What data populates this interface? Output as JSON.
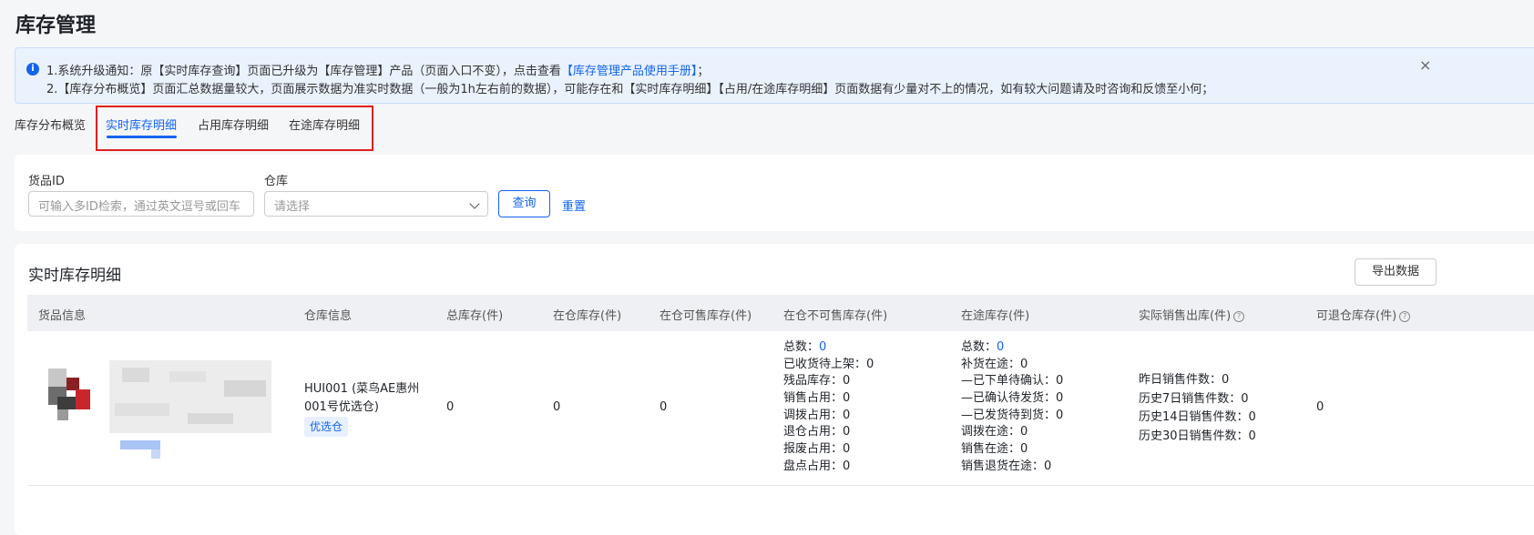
{
  "page": {
    "title": "库存管理"
  },
  "notice": {
    "line1_prefix": "1.系统升级通知：原【实时库存查询】页面已升级为【库存管理】产品（页面入口不变），点击查看",
    "line1_link": "【库存管理产品使用手册】",
    "line1_suffix": "；",
    "line2": "2.【库存分布概览】页面汇总数据量较大，页面展示数据为准实时数据（一般为1h左右前的数据），可能存在和【实时库存明细】【占用/在途库存明细】页面数据有少量对不上的情况，如有较大问题请及时咨询和反馈至小何；",
    "close": "×"
  },
  "tabs": [
    {
      "label": "库存分布概览",
      "active": false
    },
    {
      "label": "实时库存明细",
      "active": true
    },
    {
      "label": "占用库存明细",
      "active": false
    },
    {
      "label": "在途库存明细",
      "active": false
    }
  ],
  "filters": {
    "goods_id_label": "货品ID",
    "goods_id_placeholder": "可输入多ID检索，通过英文逗号或回车",
    "warehouse_label": "仓库",
    "warehouse_placeholder": "请选择",
    "query_button": "查询",
    "reset_button": "重置"
  },
  "table": {
    "title": "实时库存明细",
    "export_button": "导出数据",
    "columns": [
      "货品信息",
      "仓库信息",
      "总库存(件)",
      "在仓库存(件)",
      "在仓可售库存(件)",
      "在仓不可售库存(件)",
      "在途库存(件)",
      "实际销售出库(件)",
      "可退仓库存(件)"
    ],
    "row": {
      "warehouse_name": "HUI001 (菜鸟AE惠州",
      "warehouse_name2": "001号优选仓)",
      "warehouse_tag": "优选仓",
      "total": "0",
      "in_stock": "0",
      "sellable": "0",
      "unsellable": {
        "total_label": "总数：",
        "total_value": "0",
        "items": [
          "已收货待上架：0",
          "残品库存：0",
          "销售占用：0",
          "调拨占用：0",
          "退仓占用：0",
          "报废占用：0",
          "盘点占用：0"
        ]
      },
      "in_transit": {
        "total_label": "总数：",
        "total_value": "0",
        "items": [
          "补货在途：0",
          "—已下单待确认：0",
          "—已确认待发货：0",
          "—已发货待到货：0",
          "调拨在途：0",
          "销售在途：0",
          "销售退货在途：0"
        ]
      },
      "sales": [
        "昨日销售件数：0",
        "历史7日销售件数：0",
        "历史14日销售件数：0",
        "历史30日销售件数：0"
      ],
      "returnable": "0"
    }
  },
  "colors": {
    "accent": "#1464f0",
    "highlight": "#e02020"
  }
}
